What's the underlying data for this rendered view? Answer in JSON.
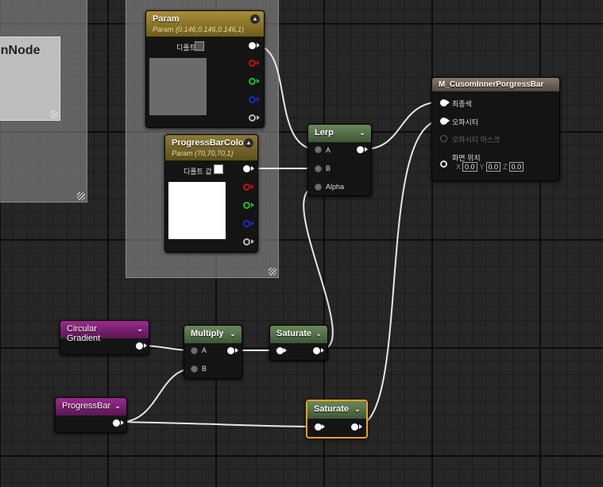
{
  "comments": [
    {
      "title": "onNode"
    }
  ],
  "nodes": {
    "param": {
      "title": "Param",
      "subtitle": "Param (0.146,0.146,0.146,1)",
      "default_label": "디폴트 값",
      "color": "#252525"
    },
    "progress_bar_color": {
      "title": "ProgressBarColor",
      "subtitle": "Param (70,70,70,1)",
      "default_label": "디폴트 값",
      "color": "#ffffff"
    },
    "lerp": {
      "title": "Lerp",
      "inputs": [
        "A",
        "B",
        "Alpha"
      ]
    },
    "result": {
      "title": "M_CusomInnerPorgressBar",
      "inputs": [
        "최종색",
        "오파시티",
        "오파시티 마스크",
        "화면 위치"
      ],
      "screen_position": {
        "x_label": "X",
        "x": "0.0",
        "y_label": "Y",
        "y": "0.0",
        "z_label": "Z",
        "z": "0.0"
      }
    },
    "circular_gradient": {
      "title": "Circular Gradient"
    },
    "multiply": {
      "title": "Multiply",
      "inputs": [
        "A",
        "B"
      ]
    },
    "saturate1": {
      "title": "Saturate"
    },
    "progress_bar": {
      "title": "ProgressBar"
    },
    "saturate2": {
      "title": "Saturate"
    }
  },
  "colors": {
    "param_header": "#a88e36",
    "math_header": "#68895a",
    "parameter_purple": "#9b2a8d",
    "selection": "#f0a21b",
    "canvas": "#262626"
  }
}
